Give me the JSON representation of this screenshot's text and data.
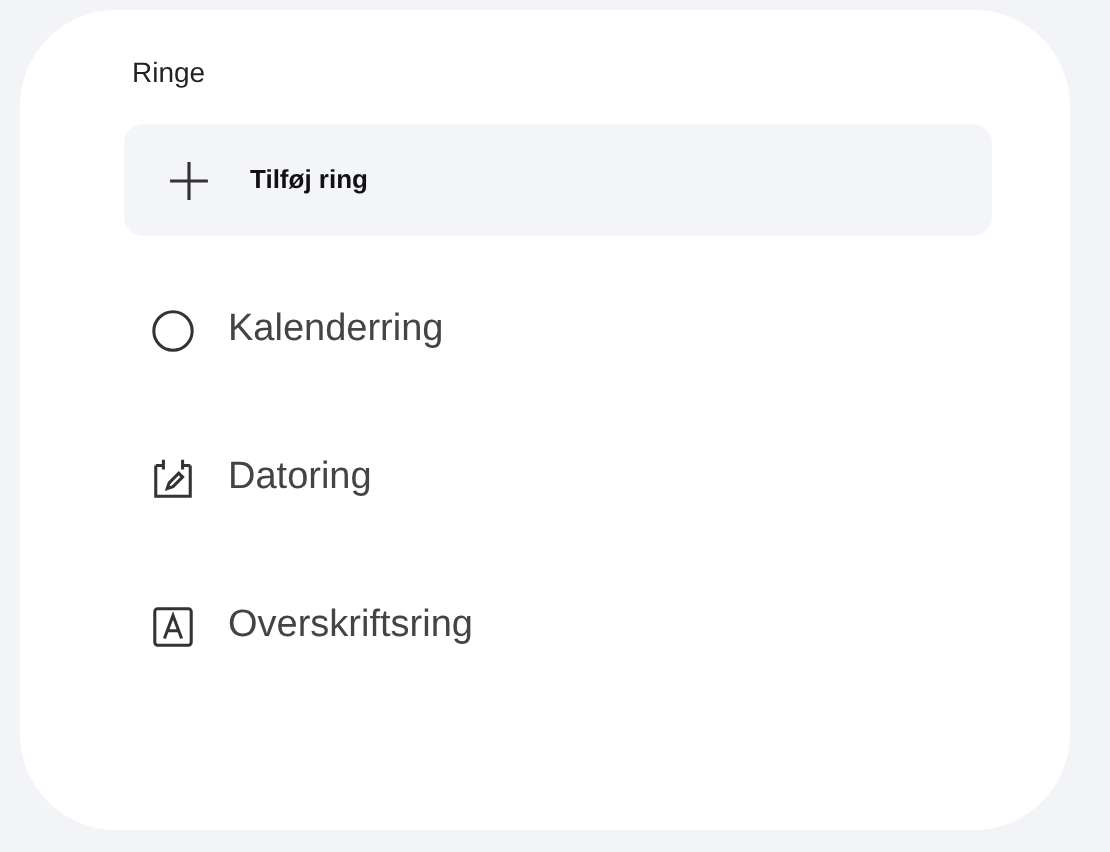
{
  "section_title": "Ringe",
  "add_button": {
    "label": "Tilføj ring"
  },
  "items": [
    {
      "kind": "circle",
      "label": "Kalenderring"
    },
    {
      "kind": "date",
      "label": "Datoring"
    },
    {
      "kind": "heading",
      "label": "Overskriftsring"
    }
  ]
}
